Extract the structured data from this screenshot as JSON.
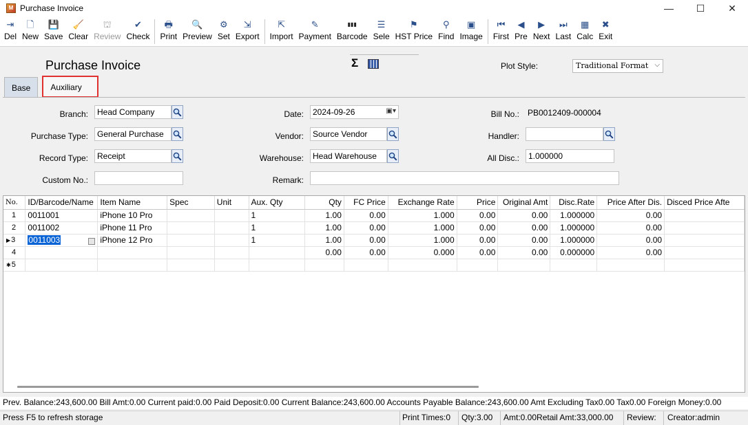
{
  "window": {
    "title": "Purchase Invoice",
    "app_icon": "app-icon",
    "minimize": "—",
    "maximize": "☐",
    "close": "✕"
  },
  "toolbar": [
    {
      "label": "Del",
      "icon": "delete-icon",
      "glyph": "⇥",
      "disabled": false
    },
    {
      "label": "New",
      "icon": "new-doc-icon",
      "glyph": "🗋",
      "disabled": false
    },
    {
      "label": "Save",
      "icon": "save-icon",
      "glyph": "💾",
      "disabled": false
    },
    {
      "label": "Clear",
      "icon": "broom-icon",
      "glyph": "🧹",
      "disabled": false
    },
    {
      "label": "Review",
      "icon": "stamp-icon",
      "glyph": "⛫",
      "disabled": true
    },
    {
      "label": "Check",
      "icon": "check-icon",
      "glyph": "✔",
      "disabled": false
    },
    {
      "sep": true
    },
    {
      "label": "Print",
      "icon": "printer-icon",
      "glyph": "🖶",
      "disabled": false
    },
    {
      "label": "Preview",
      "icon": "preview-icon",
      "glyph": "🔍",
      "disabled": false
    },
    {
      "label": "Set",
      "icon": "settings-icon",
      "glyph": "⚙",
      "disabled": false
    },
    {
      "label": "Export",
      "icon": "export-icon",
      "glyph": "⇲",
      "disabled": false
    },
    {
      "sep": true
    },
    {
      "label": "Import",
      "icon": "import-icon",
      "glyph": "⇱",
      "disabled": false
    },
    {
      "label": "Payment",
      "icon": "payment-icon",
      "glyph": "✎",
      "disabled": false
    },
    {
      "label": "Barcode",
      "icon": "barcode-icon",
      "glyph": "▮▮▮",
      "disabled": false
    },
    {
      "label": "Sele",
      "icon": "select-icon",
      "glyph": "☰",
      "disabled": false
    },
    {
      "label": "HST Price",
      "icon": "history-price-icon",
      "glyph": "⚑",
      "disabled": false
    },
    {
      "label": "Find",
      "icon": "binoculars-icon",
      "glyph": "⚲",
      "disabled": false
    },
    {
      "label": "Image",
      "icon": "image-icon",
      "glyph": "▣",
      "disabled": false
    },
    {
      "sep": true
    },
    {
      "label": "First",
      "icon": "first-icon",
      "glyph": "⏮",
      "disabled": false
    },
    {
      "label": "Pre",
      "icon": "previous-icon",
      "glyph": "◀",
      "disabled": false
    },
    {
      "label": "Next",
      "icon": "next-icon",
      "glyph": "▶",
      "disabled": false
    },
    {
      "label": "Last",
      "icon": "last-icon",
      "glyph": "⏭",
      "disabled": false
    },
    {
      "label": "Calc",
      "icon": "calculator-icon",
      "glyph": "▦",
      "disabled": false
    },
    {
      "label": "Exit",
      "icon": "exit-icon",
      "glyph": "✖",
      "disabled": false
    }
  ],
  "header": {
    "form_title": "Purchase Invoice",
    "sigma": "Σ",
    "plot_style_label": "Plot Style:",
    "plot_style_value": "Traditional Format"
  },
  "tabs": [
    {
      "label": "Base",
      "active": true
    },
    {
      "label": "Auxiliary",
      "active": false
    }
  ],
  "form": {
    "branch_label": "Branch:",
    "branch_value": "Head Company",
    "purchase_type_label": "Purchase Type:",
    "purchase_type_value": "General Purchase",
    "record_type_label": "Record Type:",
    "record_type_value": "Receipt",
    "custom_no_label": "Custom No.:",
    "custom_no_value": "",
    "date_label": "Date:",
    "date_value": "2024-09-26",
    "vendor_label": "Vendor:",
    "vendor_value": "Source Vendor",
    "warehouse_label": "Warehouse:",
    "warehouse_value": "Head Warehouse",
    "remark_label": "Remark:",
    "remark_value": "",
    "bill_no_label": "Bill No.:",
    "bill_no_value": "PB0012409-000004",
    "handler_label": "Handler:",
    "handler_value": "",
    "all_disc_label": "All Disc.:",
    "all_disc_value": "1.000000"
  },
  "grid": {
    "columns": [
      "No.",
      "ID/Barcode/Name",
      "Item Name",
      "Spec",
      "Unit",
      "Aux. Qty",
      "Qty",
      "FC Price",
      "Exchange Rate",
      "Price",
      "Original Amt",
      "Disc.Rate",
      "Price After Dis.",
      "Disced Price Afte"
    ],
    "rows": [
      {
        "no": "1",
        "marker": "",
        "id": "0011001",
        "name": "iPhone 10  Pro",
        "spec": "",
        "unit": "",
        "aux": "1",
        "qty": "1.00",
        "fc": "0.00",
        "rate": "1.000",
        "price": "0.00",
        "orig": "0.00",
        "disc": "1.000000",
        "after": "0.00",
        "discd": ""
      },
      {
        "no": "2",
        "marker": "",
        "id": "0011002",
        "name": "iPhone 11 Pro",
        "spec": "",
        "unit": "",
        "aux": "1",
        "qty": "1.00",
        "fc": "0.00",
        "rate": "1.000",
        "price": "0.00",
        "orig": "0.00",
        "disc": "1.000000",
        "after": "0.00",
        "discd": ""
      },
      {
        "no": "3",
        "marker": "▶",
        "id": "0011003",
        "name": "iPhone 12 Pro",
        "spec": "",
        "unit": "",
        "aux": "1",
        "qty": "1.00",
        "fc": "0.00",
        "rate": "1.000",
        "price": "0.00",
        "orig": "0.00",
        "disc": "1.000000",
        "after": "0.00",
        "discd": ""
      },
      {
        "no": "4",
        "marker": "",
        "id": "",
        "name": "",
        "spec": "",
        "unit": "",
        "aux": "",
        "qty": "0.00",
        "fc": "0.00",
        "rate": "0.000",
        "price": "0.00",
        "orig": "0.00",
        "disc": "0.000000",
        "after": "0.00",
        "discd": ""
      },
      {
        "no": "5",
        "marker": "✱",
        "id": "",
        "name": "",
        "spec": "",
        "unit": "",
        "aux": "",
        "qty": "",
        "fc": "",
        "rate": "",
        "price": "",
        "orig": "",
        "disc": "",
        "after": "",
        "discd": ""
      }
    ]
  },
  "status": {
    "summary": "Prev. Balance:243,600.00 Bill Amt:0.00 Current paid:0.00 Paid Deposit:0.00 Current Balance:243,600.00 Accounts Payable Balance:243,600.00 Amt Excluding Tax0.00 Tax0.00 Foreign Money:0.00",
    "hint": "Press F5 to refresh storage",
    "print_times": "Print Times:0",
    "qty": "Qty:3.00",
    "amt": "Amt:0.00Retail Amt:33,000.00",
    "review": "Review:",
    "creator": "Creator:admin"
  }
}
